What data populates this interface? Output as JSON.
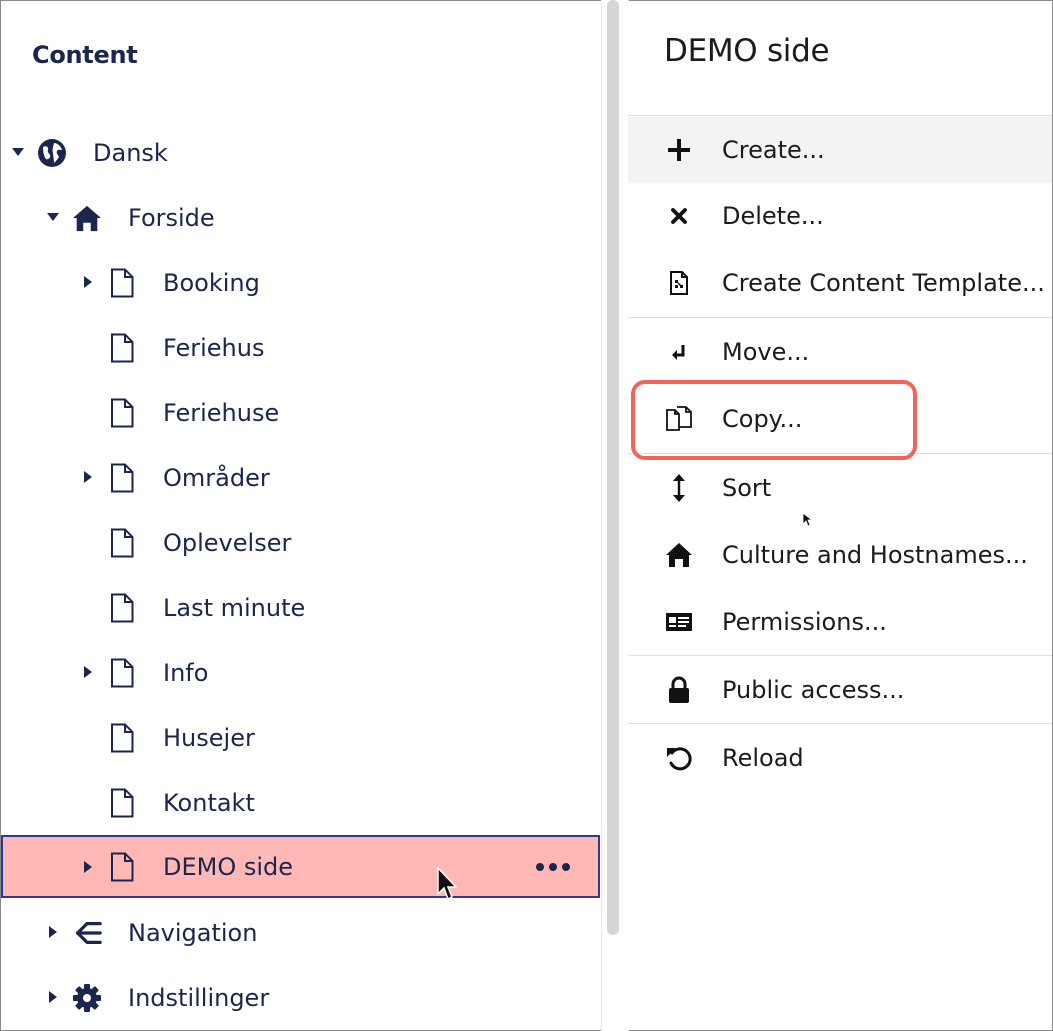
{
  "tree": {
    "title": "Content",
    "nodes": [
      {
        "label": "Dansk",
        "icon": "globe-icon",
        "expanded": true
      },
      {
        "label": "Forside",
        "icon": "home-icon",
        "expanded": true
      },
      {
        "label": "Booking",
        "icon": "document-icon",
        "expandable": true
      },
      {
        "label": "Feriehus",
        "icon": "document-icon"
      },
      {
        "label": "Feriehuse",
        "icon": "document-icon"
      },
      {
        "label": "Områder",
        "icon": "document-icon",
        "expandable": true
      },
      {
        "label": "Oplevelser",
        "icon": "document-icon"
      },
      {
        "label": "Last minute",
        "icon": "document-icon"
      },
      {
        "label": "Info",
        "icon": "document-icon",
        "expandable": true
      },
      {
        "label": "Husejer",
        "icon": "document-icon"
      },
      {
        "label": "Kontakt",
        "icon": "document-icon"
      },
      {
        "label": "DEMO side",
        "icon": "document-icon",
        "expandable": true,
        "selected": true
      },
      {
        "label": "Navigation",
        "icon": "sitemap-icon",
        "expandable": true
      },
      {
        "label": "Indstillinger",
        "icon": "gear-icon",
        "expandable": true
      }
    ]
  },
  "actions": {
    "title": "DEMO side",
    "items": [
      {
        "label": "Create...",
        "icon": "plus-icon"
      },
      {
        "label": "Delete...",
        "icon": "close-icon"
      },
      {
        "label": "Create Content Template...",
        "icon": "template-icon"
      },
      {
        "label": "Move...",
        "icon": "move-icon"
      },
      {
        "label": "Copy...",
        "icon": "copy-icon"
      },
      {
        "label": "Sort",
        "icon": "sort-icon"
      },
      {
        "label": "Culture and Hostnames...",
        "icon": "home-icon"
      },
      {
        "label": "Permissions...",
        "icon": "id-card-icon"
      },
      {
        "label": "Public access...",
        "icon": "lock-icon"
      },
      {
        "label": "Reload",
        "icon": "reload-icon"
      }
    ]
  },
  "colors": {
    "navy": "#1b264f",
    "selected_bg": "#ffb8b6",
    "selected_border": "#2b3a9a",
    "copy_highlight": "#f2645a"
  }
}
